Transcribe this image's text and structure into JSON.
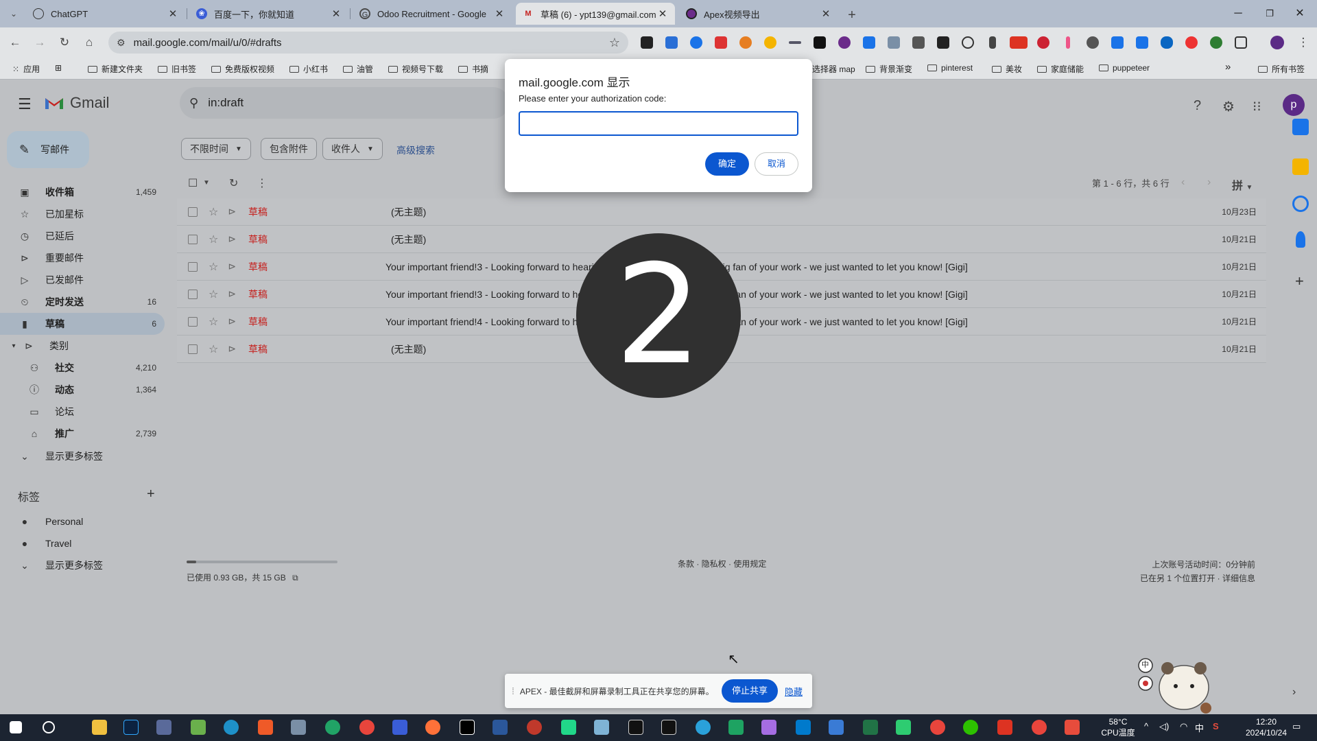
{
  "browser": {
    "tabs": [
      {
        "title": "ChatGPT",
        "icon": "chatgpt-icon"
      },
      {
        "title": "百度一下，你就知道",
        "icon": "baidu-icon"
      },
      {
        "title": "Odoo Recruitment - Google",
        "icon": "google-icon"
      },
      {
        "title": "草稿 (6) - ypt139@gmail.com",
        "icon": "gmail-icon"
      },
      {
        "title": "Apex视频导出",
        "icon": "apex-icon"
      }
    ],
    "active_tab_index": 3,
    "url": "mail.google.com/mail/u/0/#drafts",
    "new_tab": "+"
  },
  "bookmarks": {
    "items": [
      "应用",
      "新建文件夹",
      "旧书签",
      "免费版权视频",
      "小红书",
      "油管",
      "视频号下载",
      "书摘",
      "选择器 map",
      "背景渐变",
      "pinterest",
      "美妆",
      "家庭储能",
      "puppeteer"
    ],
    "all_bookmarks": "所有书签",
    "more": "»"
  },
  "gmail": {
    "logo_text": "Gmail",
    "search_query": "in:draft",
    "avatar_letter": "p",
    "compose_label": "写邮件",
    "nav": [
      {
        "label": "收件箱",
        "count": "1,459",
        "icon": "inbox-icon",
        "bold": true
      },
      {
        "label": "已加星标",
        "count": "",
        "icon": "star-icon",
        "bold": false
      },
      {
        "label": "已延后",
        "count": "",
        "icon": "clock-icon",
        "bold": false
      },
      {
        "label": "重要邮件",
        "count": "",
        "icon": "important-icon",
        "bold": false
      },
      {
        "label": "已发邮件",
        "count": "",
        "icon": "send-icon",
        "bold": false
      },
      {
        "label": "定时发送",
        "count": "16",
        "icon": "scheduled-icon",
        "bold": true
      },
      {
        "label": "草稿",
        "count": "6",
        "icon": "draft-icon",
        "bold": true
      },
      {
        "label": "类别",
        "count": "",
        "icon": "label-icon",
        "bold": false
      }
    ],
    "categories": [
      {
        "label": "社交",
        "count": "4,210",
        "icon": "people-icon",
        "bold": true
      },
      {
        "label": "动态",
        "count": "1,364",
        "icon": "info-icon",
        "bold": true
      },
      {
        "label": "论坛",
        "count": "",
        "icon": "forum-icon",
        "bold": false
      },
      {
        "label": "推广",
        "count": "2,739",
        "icon": "tag-icon",
        "bold": true
      }
    ],
    "show_more_1": "显示更多标签",
    "labels_heading": "标签",
    "labels": [
      {
        "label": "Personal",
        "icon": "label-dot-icon"
      },
      {
        "label": "Travel",
        "icon": "label-dot-icon"
      }
    ],
    "show_more_2": "显示更多标签",
    "filters": [
      "不限时间",
      "包含附件",
      "收件人"
    ],
    "advanced_search": "高级搜索",
    "pager": "第 1 - 6 行，共 6 行",
    "sort_label": "拼",
    "rows": [
      {
        "sender": "草稿",
        "subject": "(无主题)",
        "date": "10月23日"
      },
      {
        "sender": "草稿",
        "subject": "(无主题)",
        "date": "10月21日"
      },
      {
        "sender": "草稿",
        "subject": "Your important friend!3 - Looking forward to hearing from you soon! PS : I'm a big fan of your work - we just wanted to let you know! [Gigi]",
        "date": "10月21日"
      },
      {
        "sender": "草稿",
        "subject": "Your important friend!3 - Looking forward to hearing from you soon! PS : I'm a big fan of your work - we just wanted to let you know! [Gigi]",
        "date": "10月21日"
      },
      {
        "sender": "草稿",
        "subject": "Your important friend!4 - Looking forward to hearing from you soon! PS : I'm a big fan of your work - we just wanted to let you know! [Gigi]",
        "date": "10月21日"
      },
      {
        "sender": "草稿",
        "subject": "(无主题)",
        "date": "10月21日"
      }
    ],
    "storage_text": "已使用 0.93 GB，共 15 GB",
    "storage_fraction": 0.062,
    "terms": "条款 · 隐私权 · 使用规定",
    "activity_line1": "上次账号活动时间：0分钟前",
    "activity_line2": "已在另 1 个位置打开 · 详细信息"
  },
  "dialog": {
    "title": "mail.google.com 显示",
    "message": "Please enter your authorization code:",
    "input_value": "",
    "ok_label": "确定",
    "cancel_label": "取消"
  },
  "countdown": "2",
  "sharebar": {
    "message": "APEX - 最佳截屏和屏幕录制工具正在共享您的屏幕。",
    "stop_label": "停止共享",
    "hide_label": "隐藏"
  },
  "mascot_badge": "中",
  "taskbar": {
    "temp_value": "58°C",
    "temp_label": "CPU温度",
    "time": "12:20",
    "date": "2024/10/24",
    "ime": "中"
  }
}
